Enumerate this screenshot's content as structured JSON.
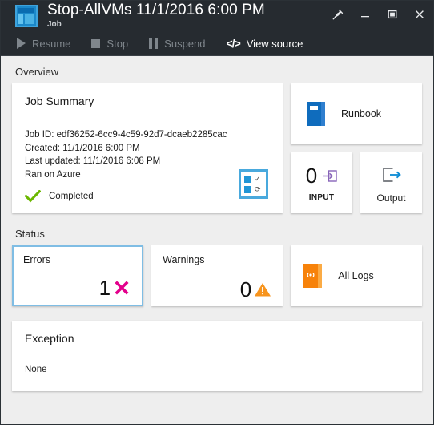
{
  "window": {
    "title": "Stop-AllVMs 11/1/2016 6:00 PM",
    "subtitle": "Job",
    "app_icon": "blade-dashboard-icon",
    "controls": {
      "pin": "pin-icon",
      "minimize": "minimize-icon",
      "maximize": "maximize-icon",
      "close": "close-icon"
    }
  },
  "commandbar": {
    "items": [
      {
        "label": "Resume",
        "icon": "play-icon",
        "enabled": false
      },
      {
        "label": "Stop",
        "icon": "stop-square-icon",
        "enabled": false
      },
      {
        "label": "Suspend",
        "icon": "pause-bars-icon",
        "enabled": false
      },
      {
        "label": "View source",
        "icon": "code-brackets-icon",
        "enabled": true
      }
    ]
  },
  "overview": {
    "section_label": "Overview",
    "job_summary": {
      "heading": "Job Summary",
      "job_id_line": "Job ID: edf36252-6cc9-4c59-92d7-dcaeb2285cac",
      "created_line": "Created: 11/1/2016 6:00 PM",
      "updated_line": "Last updated: 11/1/2016 6:08 PM",
      "ran_on_line": "Ran on Azure",
      "status_text": "Completed",
      "status_icon": "green-check-icon",
      "corner_icon": "checklist-icon"
    },
    "runbook": {
      "label": "Runbook",
      "icon": "blue-book-icon"
    },
    "input": {
      "count": "0",
      "caption": "INPUT",
      "icon": "arrow-into-box-icon"
    },
    "output": {
      "caption": "Output",
      "icon": "arrow-out-of-box-icon"
    }
  },
  "status": {
    "section_label": "Status",
    "errors": {
      "label": "Errors",
      "count": "1",
      "icon": "error-x-icon",
      "selected": true
    },
    "warnings": {
      "label": "Warnings",
      "count": "0",
      "icon": "warning-triangle-icon",
      "selected": false
    },
    "all_logs": {
      "label": "All Logs",
      "icon": "orange-log-book-icon"
    }
  },
  "exception": {
    "heading": "Exception",
    "value": "None"
  },
  "colors": {
    "titlebar_bg": "#262b30",
    "page_bg": "#eeeeee",
    "tile_bg": "#ffffff",
    "accent_blue": "#0078d4",
    "selection_border": "#7fbde4",
    "success_green": "#6bb700",
    "error_magenta": "#e3008c",
    "warning_orange": "#f7941d",
    "input_purple": "#8764b8",
    "logs_orange": "#f7820a"
  }
}
